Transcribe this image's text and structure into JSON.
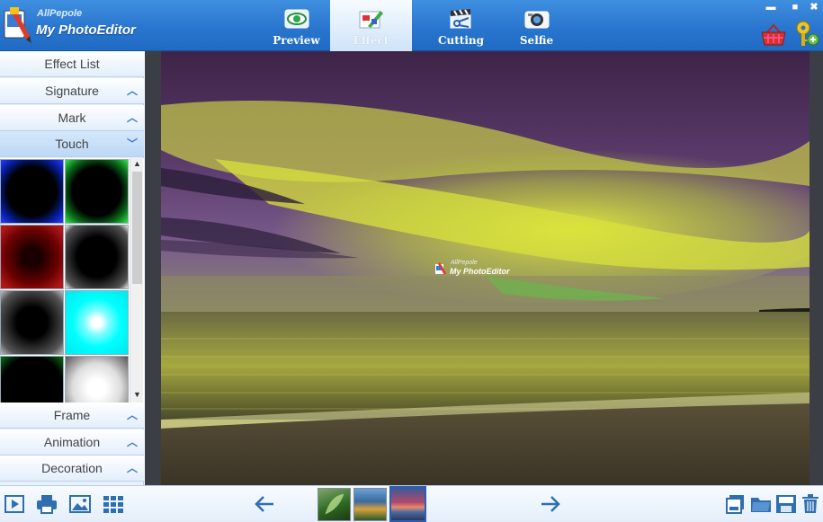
{
  "app": {
    "brand_small": "AllPepole",
    "brand_name": "My PhotoEditor"
  },
  "tabs": [
    {
      "label": "Preview",
      "icon": "eye-icon",
      "active": false
    },
    {
      "label": "Effect",
      "icon": "brush-icon",
      "active": true
    },
    {
      "label": "Cutting",
      "icon": "clapper-scissors-icon",
      "active": false
    },
    {
      "label": "Selfie",
      "icon": "camera-icon",
      "active": false
    }
  ],
  "window_controls": {
    "minimize": "▬",
    "maximize": "■",
    "close": "✖"
  },
  "sidebar": {
    "header": "Effect List",
    "sections_top": [
      {
        "label": "Signature",
        "chevron": "︿"
      },
      {
        "label": "Mark",
        "chevron": "︿"
      },
      {
        "label": "Touch",
        "chevron": "﹀"
      }
    ],
    "touch_thumbnails": [
      {
        "name": "blue-vignette",
        "color": "#1010d0"
      },
      {
        "name": "green-vignette",
        "color": "#10c020"
      },
      {
        "name": "red-vignette",
        "color": "#a01010"
      },
      {
        "name": "white-soft-vignette",
        "color": "#f0f0f0"
      },
      {
        "name": "gray-vignette",
        "color": "#c0c0c0"
      },
      {
        "name": "cyan-glow",
        "color": "#00ffff"
      },
      {
        "name": "green-edge",
        "color": "#10a020"
      },
      {
        "name": "white-glow",
        "color": "#ffffff"
      }
    ],
    "sections_bottom": [
      {
        "label": "Frame",
        "chevron": "︿"
      },
      {
        "label": "Animation",
        "chevron": "︿"
      },
      {
        "label": "Decoration",
        "chevron": "︿"
      }
    ],
    "scroll_up": "▲",
    "scroll_down": "▼"
  },
  "canvas": {
    "watermark_small": "AllPepole",
    "watermark_big": "My PhotoEditor"
  },
  "bottom": {
    "left_icons": [
      "play-icon",
      "print-icon",
      "image-icon",
      "grid-icon"
    ],
    "prev_icon": "arrow-left-icon",
    "next_icon": "arrow-right-icon",
    "filmstrip": [
      {
        "name": "green-leaf-photo",
        "selected": false
      },
      {
        "name": "coastal-flowers-photo",
        "selected": false
      },
      {
        "name": "sunset-beach-photo",
        "selected": true
      }
    ],
    "right_icons": [
      "layers-icon",
      "folder-icon",
      "save-icon",
      "trash-icon"
    ]
  }
}
